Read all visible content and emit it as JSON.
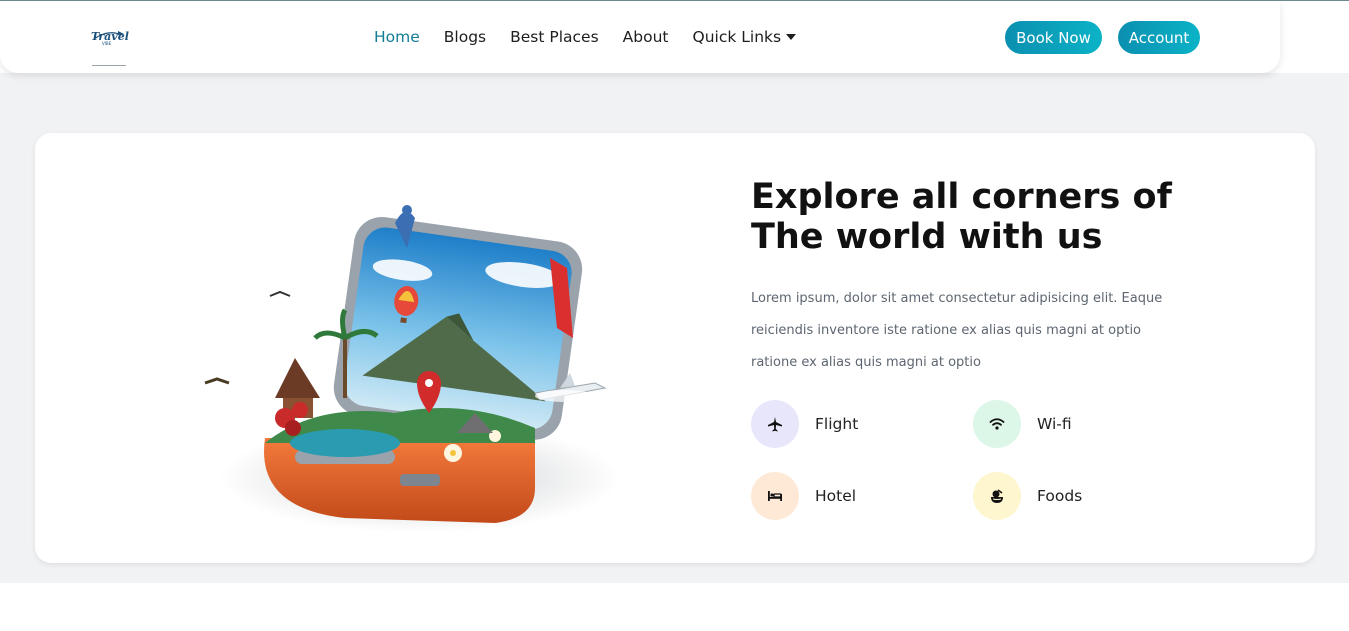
{
  "brand": {
    "logo_alt": "Travel Vibe logo"
  },
  "nav": {
    "items": [
      {
        "label": "Home",
        "active": true
      },
      {
        "label": "Blogs"
      },
      {
        "label": "Best Places"
      },
      {
        "label": "About"
      },
      {
        "label": "Quick Links",
        "dropdown": true
      }
    ],
    "book_label": "Book Now",
    "account_label": "Account"
  },
  "hero": {
    "title_line1": "Explore all corners of",
    "title_line2": "The world with us",
    "desc_line1": "Lorem ipsum, dolor sit amet consectetur adipisicing elit. Eaque",
    "desc_line2": "reiciendis inventore iste ratione ex alias quis magni at optio",
    "desc_line3": "ratione ex alias quis magni at optio",
    "illustration": "open-suitcase-with-landscape"
  },
  "features": [
    {
      "label": "Flight",
      "icon": "plane-icon",
      "bg": "#e8e6fb"
    },
    {
      "label": "Wi-fi",
      "icon": "wifi-icon",
      "bg": "#dcf6e8"
    },
    {
      "label": "Hotel",
      "icon": "bed-icon",
      "bg": "#fde9d6"
    },
    {
      "label": "Foods",
      "icon": "food-icon",
      "bg": "#fdf6cf"
    }
  ],
  "colors": {
    "accent": "#127d96",
    "button_start": "#0b8fb0",
    "button_end": "#0bb3c7",
    "page_band": "#f1f2f4"
  }
}
